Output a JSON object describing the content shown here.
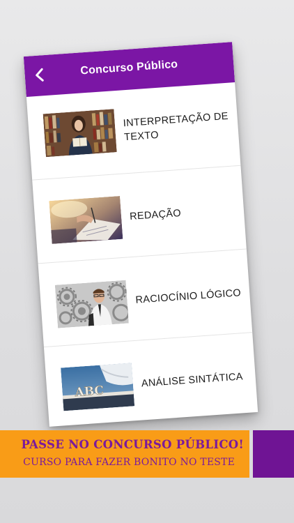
{
  "nav": {
    "title": "Concurso Público",
    "back_icon": "chevron-left-icon"
  },
  "items": [
    {
      "label_line1": "INTERPRETAÇÃO DE",
      "label_line2": "TEXTO",
      "image": "woman-reading-in-library"
    },
    {
      "label_line1": "REDAÇÃO",
      "image": "hand-writing-on-paper"
    },
    {
      "label_line1": "RACIOCÍNIO LÓGICO",
      "image": "man-with-gears"
    },
    {
      "label_line1": "ANÁLISE SINTÁTICA",
      "image": "abc-blocks-on-book"
    }
  ],
  "banner": {
    "headline": "PASSE NO CONCURSO PÚBLICO!",
    "subline": "CURSO PARA FAZER BONITO NO TESTE"
  },
  "colors": {
    "nav": "#7b16a5",
    "banner_orange": "#f99c17",
    "banner_purple": "#6f1494",
    "banner_text": "#7b1a9c"
  }
}
